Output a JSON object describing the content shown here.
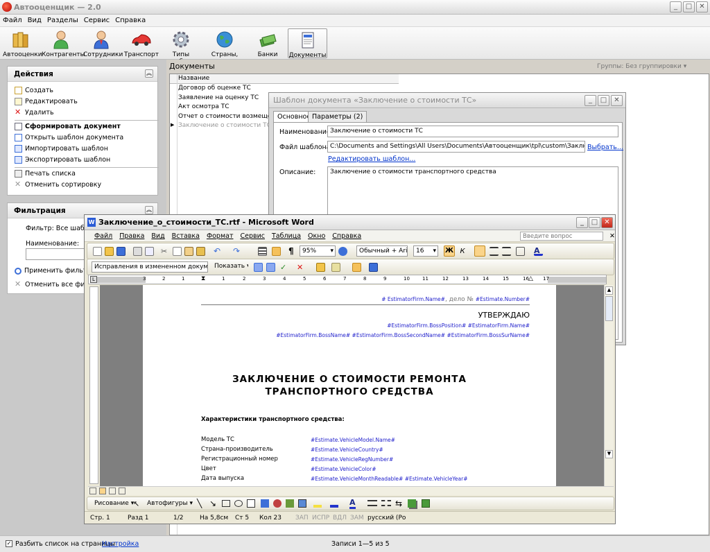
{
  "app": {
    "title": "Автооценщик — 2.0"
  },
  "window_buttons": {
    "min": "_",
    "max": "□",
    "close": "✕"
  },
  "menubar": [
    "Файл",
    "Вид",
    "Разделы",
    "Сервис",
    "Справка"
  ],
  "toolbar": [
    {
      "label": "Автооценки",
      "icon": "books-icon"
    },
    {
      "label": "Контрагенты",
      "icon": "person-green-icon"
    },
    {
      "label": "Сотрудники",
      "icon": "person-blue-icon"
    },
    {
      "label": "Транспорт",
      "icon": "car-icon"
    },
    {
      "label": "Типы работ",
      "icon": "gear-icon"
    },
    {
      "label": "Страны, города",
      "icon": "globe-icon"
    },
    {
      "label": "Банки",
      "icon": "money-icon"
    },
    {
      "label": "Документы",
      "icon": "document-icon"
    }
  ],
  "actions_panel": {
    "title": "Действия",
    "items": [
      "Создать",
      "Редактировать",
      "Удалить",
      "Сформировать документ",
      "Открыть шаблон документа",
      "Импортировать шаблон",
      "Экспортировать шаблон",
      "Печать списка",
      "Отменить сортировку"
    ]
  },
  "filter_panel": {
    "title": "Фильтрация",
    "filter_label": "Фильтр: Все шаблоны",
    "name_label": "Наименование:",
    "apply": "Применить фильтр",
    "reset": "Отменить все фильтры"
  },
  "documents": {
    "title": "Документы",
    "grouping": "Группы: Без группировки",
    "column": "Название",
    "rows": [
      "Договор об оценке ТС",
      "Заявление на оценку ТС",
      "Акт осмотра ТС",
      "Отчет о стоимости возмещения",
      "Заключение о стоимости ТС"
    ]
  },
  "dialog": {
    "title": "Шаблон документа «Заключение о стоимости ТС»",
    "tabs": [
      "Основное",
      "Параметры (2)"
    ],
    "name_label": "Наименование:",
    "name_value": "Заключение о стоимости ТС",
    "file_label": "Файл шаблона:",
    "file_value": "C:\\Documents and Settings\\All Users\\Documents\\Автооценщик\\tpl\\custom\\Заключение_о_ст",
    "choose": "Выбрать...",
    "edit_template": "Редактировать шаблон...",
    "desc_label": "Описание:",
    "desc_value": "Заключение о стоимости транспортного средства"
  },
  "word": {
    "title": "Заключение_о_стоимости_ТС.rtf - Microsoft Word",
    "menu": [
      "Файл",
      "Правка",
      "Вид",
      "Вставка",
      "Формат",
      "Сервис",
      "Таблица",
      "Окно",
      "Справка"
    ],
    "ask": "Введите вопрос",
    "zoom": "95%",
    "style": "Обычный + Aria",
    "size": "16",
    "bold": "Ж",
    "italic": "К",
    "track": "Исправления в измененном документе",
    "show": "Показать",
    "ruler_nums": [
      "3",
      "2",
      "1",
      "1",
      "2",
      "3",
      "4",
      "5",
      "6",
      "7",
      "8",
      "9",
      "10",
      "11",
      "12",
      "13",
      "14",
      "15",
      "16",
      "17"
    ],
    "ruler_marker": "L",
    "header_line": "# EstimatorFirm.Name#, дело № #Estimate.Number#",
    "header_parts": [
      "# EstimatorFirm.Name#",
      ", дело № ",
      "#Estimate.Number#"
    ],
    "approve": "УТВЕРЖДАЮ",
    "boss_line1": "#EstimatorFirm.BossPosition# #EstimatorFirm.Name#",
    "boss_line2": "#EstimatorFirm.BossName# #EstimatorFirm.BossSecondName# #EstimatorFirm.BossSurName#",
    "heading1": "ЗАКЛЮЧЕНИЕ О СТОИМОСТИ РЕМОНТА",
    "heading2": "ТРАНСПОРТНОГО СРЕДСТВА",
    "section": "Характеристики транспортного средства:",
    "fields": [
      {
        "label": "Модель ТС",
        "value": "#Estimate.VehicleModel.Name#"
      },
      {
        "label": "Страна-производитель",
        "value": "#Estimate.VehicleCountry#"
      },
      {
        "label": "Регистрационный номер",
        "value": "#Estimate.VehicleRegNumber#"
      },
      {
        "label": "Цвет",
        "value": "#Estimate.VehicleColor#"
      },
      {
        "label": "Дата выпуска",
        "value": "#Estimate.VehicleMonthReadable# #Estimate.VehicleYear#"
      }
    ],
    "draw": "Рисование",
    "autoshapes": "Автофигуры",
    "status": [
      "Стр. 1",
      "Разд 1",
      "1/2",
      "На 5,8см",
      "Ст 5",
      "Кол 23",
      "ЗАП",
      "ИСПР",
      "ВДЛ",
      "ЗАМ",
      "русский (Ро"
    ]
  },
  "bottom": {
    "paging": "Разбить список на страницы",
    "settings": "Настройка",
    "records": "Записи 1—5 из 5"
  }
}
